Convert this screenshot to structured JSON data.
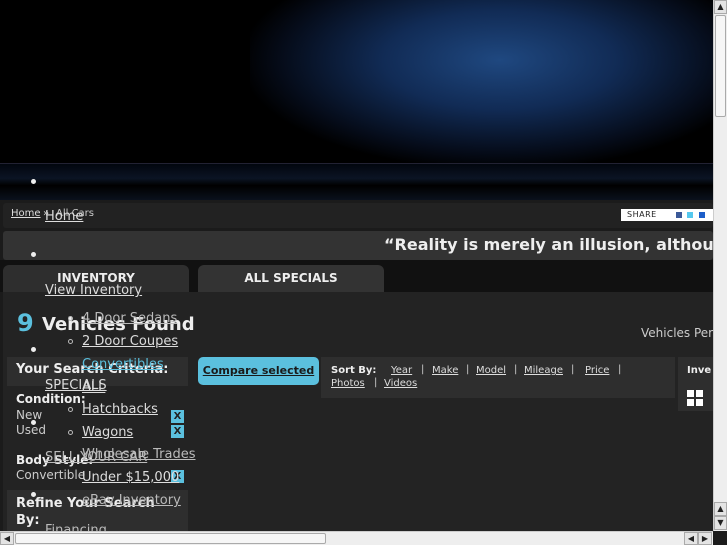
{
  "breadcrumb": {
    "home": "Home",
    "separator": "»",
    "current": "All Cars"
  },
  "share": {
    "label": "SHARE",
    "icons": [
      "facebook-icon",
      "twitter-icon",
      "myspace-icon"
    ]
  },
  "quote": "“Reality is merely an illusion, althou",
  "tabs": [
    {
      "label": "INVENTORY"
    },
    {
      "label": "ALL SPECIALS"
    }
  ],
  "nav": {
    "home": "Home",
    "view_inventory": "View Inventory",
    "inventory_sub": [
      "4 Door Sedans",
      "2 Door Coupes",
      "Convertibles"
    ],
    "specials": "SPECIALS",
    "specials_sub": [
      "ALL",
      "Hatchbacks",
      "Wagons",
      "Wholesale Trades"
    ],
    "sell": "SELL YOUR CAR",
    "sell_sub": [
      "Under $15,000",
      "eBay Inventory"
    ],
    "financing": "Financing"
  },
  "results": {
    "count": "9",
    "label": "Vehicles Found",
    "per_page_label": "Vehicles Per"
  },
  "criteria": {
    "title": "Your Search Criteria:",
    "condition_label": "Condition:",
    "conditions": [
      "New",
      "Used"
    ],
    "body_style_label": "Body Style:",
    "body_styles": [
      "Convertible"
    ],
    "remove_label": "X"
  },
  "refine": {
    "title": "Refine Your Search By:"
  },
  "compare_button": "Compare selected",
  "sort": {
    "label": "Sort By:",
    "options": [
      "Year",
      "Make",
      "Model",
      "Mileage",
      "Price",
      "Photos",
      "Videos"
    ],
    "separator": "|"
  },
  "inventory_view": {
    "label": "Inve",
    "icon": "grid-icon"
  },
  "colors": {
    "accent": "#5bc0de",
    "background": "#1b1b1b"
  }
}
